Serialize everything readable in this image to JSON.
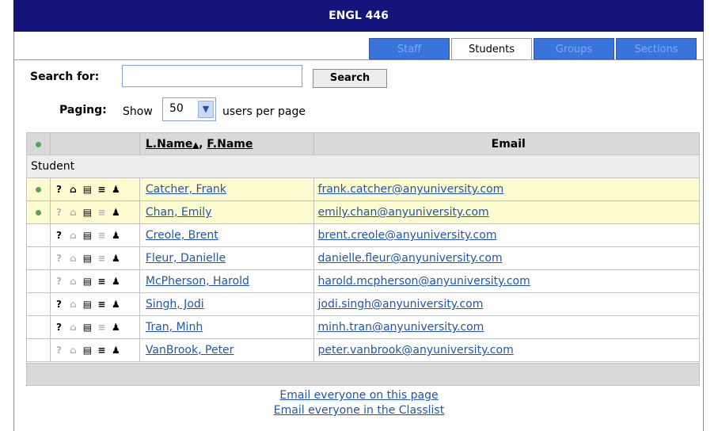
{
  "title": "ENGL 446",
  "tabs": [
    {
      "label": "Staff",
      "active": false
    },
    {
      "label": "Students",
      "active": true
    },
    {
      "label": "Groups",
      "active": false
    },
    {
      "label": "Sections",
      "active": false
    }
  ],
  "search": {
    "label": "Search for:",
    "value": "",
    "button": "Search"
  },
  "paging": {
    "label": "Paging:",
    "show": "Show",
    "value": "50",
    "suffix": "users per page"
  },
  "table": {
    "headers": {
      "name_last": "L.Name",
      "sort_arrow": "▲",
      "sep": ",",
      "name_first": "F.Name",
      "email": "Email"
    },
    "group_label": "Student",
    "rows": [
      {
        "name": "Catcher, Frank",
        "email": "frank.catcher@anyuniversity.com",
        "online": true,
        "highlight": true,
        "icons": [
          true,
          true,
          true,
          true,
          true
        ]
      },
      {
        "name": "Chan, Emily",
        "email": "emily.chan@anyuniversity.com",
        "online": true,
        "highlight": true,
        "icons": [
          false,
          false,
          true,
          false,
          true
        ]
      },
      {
        "name": "Creole, Brent",
        "email": "brent.creole@anyuniversity.com",
        "online": false,
        "highlight": false,
        "icons": [
          true,
          false,
          true,
          false,
          true
        ]
      },
      {
        "name": "Fleur, Danielle",
        "email": "danielle.fleur@anyuniversity.com",
        "online": false,
        "highlight": false,
        "icons": [
          false,
          false,
          true,
          false,
          true
        ]
      },
      {
        "name": "McPherson, Harold",
        "email": "harold.mcpherson@anyuniversity.com",
        "online": false,
        "highlight": false,
        "icons": [
          false,
          false,
          true,
          true,
          true
        ]
      },
      {
        "name": "Singh, Jodi",
        "email": "jodi.singh@anyuniversity.com",
        "online": false,
        "highlight": false,
        "icons": [
          true,
          false,
          true,
          true,
          true
        ]
      },
      {
        "name": "Tran, Minh",
        "email": "minh.tran@anyuniversity.com",
        "online": false,
        "highlight": false,
        "icons": [
          true,
          false,
          true,
          false,
          true
        ]
      },
      {
        "name": "VanBrook, Peter",
        "email": "peter.vanbrook@anyuniversity.com",
        "online": false,
        "highlight": false,
        "icons": [
          false,
          false,
          true,
          true,
          true
        ]
      }
    ]
  },
  "icon_names": [
    "help-icon",
    "home-icon",
    "profile-icon",
    "grades-icon",
    "user-icon"
  ],
  "links": {
    "email_page": "Email everyone on this page",
    "email_classlist": "Email everyone in the Classlist"
  },
  "colors": {
    "titlebar": "#14147a",
    "tab_inactive": "#3a74db",
    "row_highlight": "#fdfbd0",
    "online_dot": "#57a35b",
    "link": "#2255a8"
  }
}
